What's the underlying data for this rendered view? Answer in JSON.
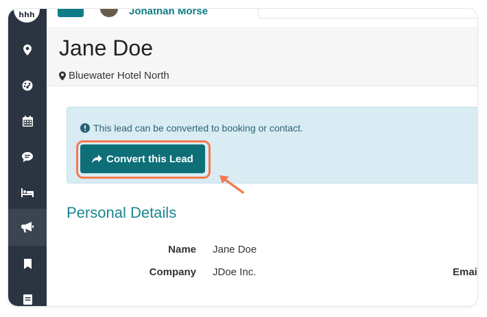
{
  "sidebar": {
    "logo_text": "hhh",
    "items": [
      {
        "icon": "map-marker-icon",
        "active": false
      },
      {
        "icon": "dashboard-icon",
        "active": false
      },
      {
        "icon": "calendar-icon",
        "active": false
      },
      {
        "icon": "comment-icon",
        "active": false
      },
      {
        "icon": "bed-icon",
        "active": false
      },
      {
        "icon": "bullhorn-icon",
        "active": true
      },
      {
        "icon": "bookmark-icon",
        "active": false
      },
      {
        "icon": "document-icon",
        "active": false
      }
    ]
  },
  "topbar": {
    "user_name": "Jonathan Morse"
  },
  "header": {
    "title": "Jane Doe",
    "location": "Bluewater Hotel North"
  },
  "alert": {
    "message": "This lead can be converted to booking or contact.",
    "button_label": "Convert this Lead"
  },
  "personal_details": {
    "section_title": "Personal Details",
    "rows": [
      {
        "label": "Name",
        "value": "Jane Doe"
      },
      {
        "label": "Company",
        "value": "JDoe Inc."
      }
    ],
    "email_label": "Emai"
  },
  "colors": {
    "sidebar_bg": "#2b3441",
    "accent_teal": "#0e6f79",
    "alert_bg": "#d9ecf3",
    "highlight": "#f4794d"
  }
}
